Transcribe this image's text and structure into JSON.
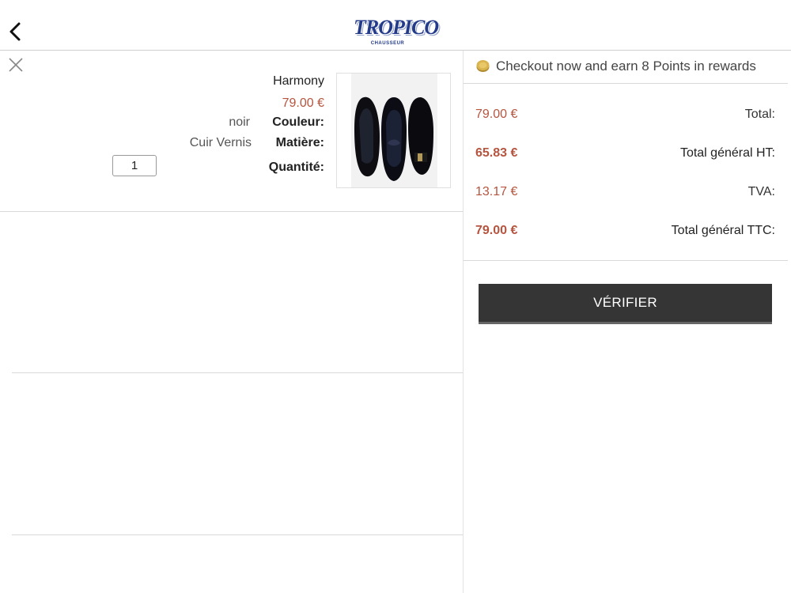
{
  "header": {
    "back_icon": "chevron-left-icon",
    "logo": {
      "word": "TROPICO",
      "sub": "CHAUSSEUR"
    }
  },
  "cart_item": {
    "close_icon": "close-icon",
    "name": "Harmony",
    "price": "79.00 €",
    "color_label": "Couleur:",
    "color_value": "noir",
    "material_label": "Matière:",
    "material_value": "Cuir Vernis",
    "quantity_label": "Quantité:",
    "quantity_value": "1"
  },
  "summary": {
    "rewards_icon": "coin-icon",
    "rewards_text": "Checkout now and earn 8 Points in rewards",
    "rows": [
      {
        "label": "Total:",
        "value": "79.00 €"
      },
      {
        "label": "Total général HT:",
        "value": "65.83 €"
      },
      {
        "label": "TVA:",
        "value": "13.17 €"
      },
      {
        "label": "Total général TTC:",
        "value": "79.00 €"
      }
    ],
    "verify_label": "VÉRIFIER"
  },
  "colors": {
    "price": "#b5543f",
    "button_bg": "#353535",
    "logo": "#243b8a"
  }
}
